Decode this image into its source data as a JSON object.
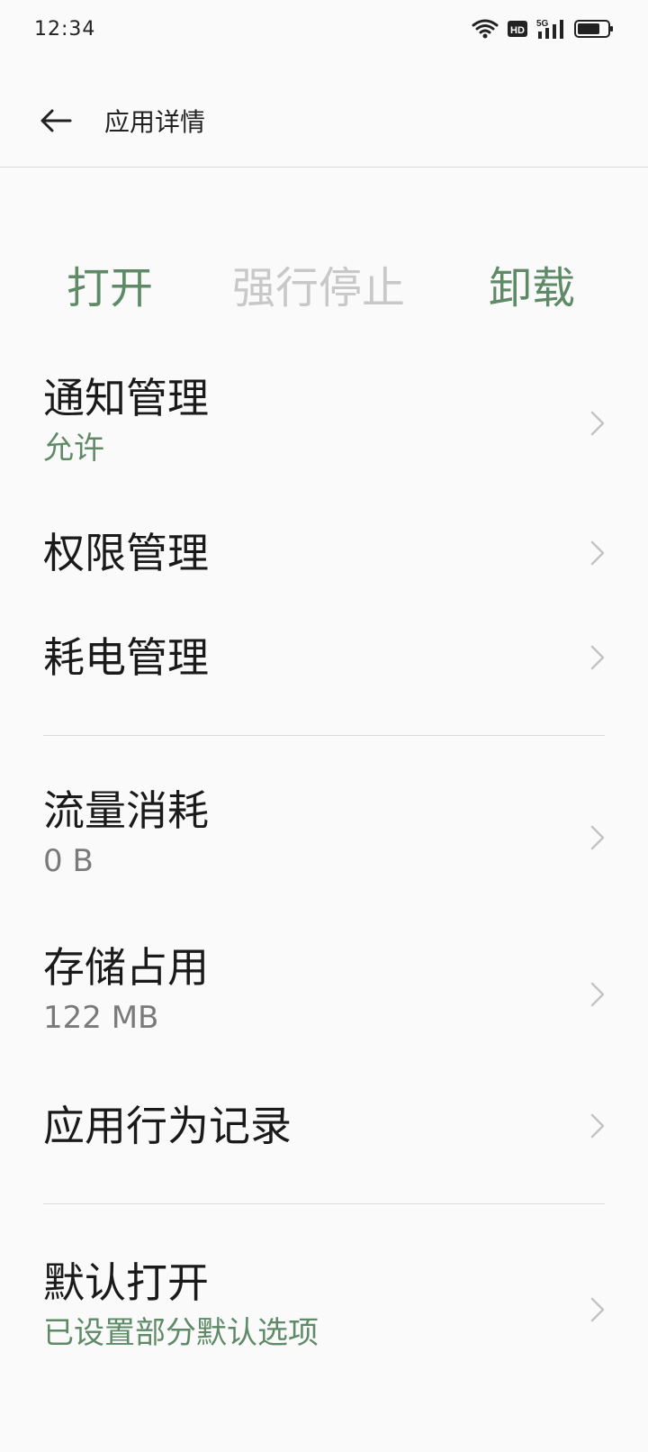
{
  "status_bar": {
    "time": "12:34",
    "icons": [
      "wifi-icon",
      "hd-icon",
      "signal-5g-icon",
      "battery-icon"
    ],
    "hd_label": "HD",
    "network_label": "5G"
  },
  "app_bar": {
    "back_icon": "back-arrow-icon",
    "title": "应用详情"
  },
  "actions": {
    "open": "打开",
    "force_stop": "强行停止",
    "uninstall": "卸载"
  },
  "items": [
    {
      "title": "通知管理",
      "subtitle": "允许"
    },
    {
      "title": "权限管理"
    },
    {
      "title": "耗电管理"
    },
    {
      "title": "流量消耗",
      "subtitle": "0 B"
    },
    {
      "title": "存储占用",
      "subtitle": "122 MB"
    },
    {
      "title": "应用行为记录"
    },
    {
      "title": "默认打开",
      "subtitle": "已设置部分默认选项"
    }
  ],
  "colors": {
    "accent": "#5e8a68",
    "disabled": "#c8c8c8",
    "background": "#fafafa",
    "secondary_text": "#7a7a7a"
  }
}
